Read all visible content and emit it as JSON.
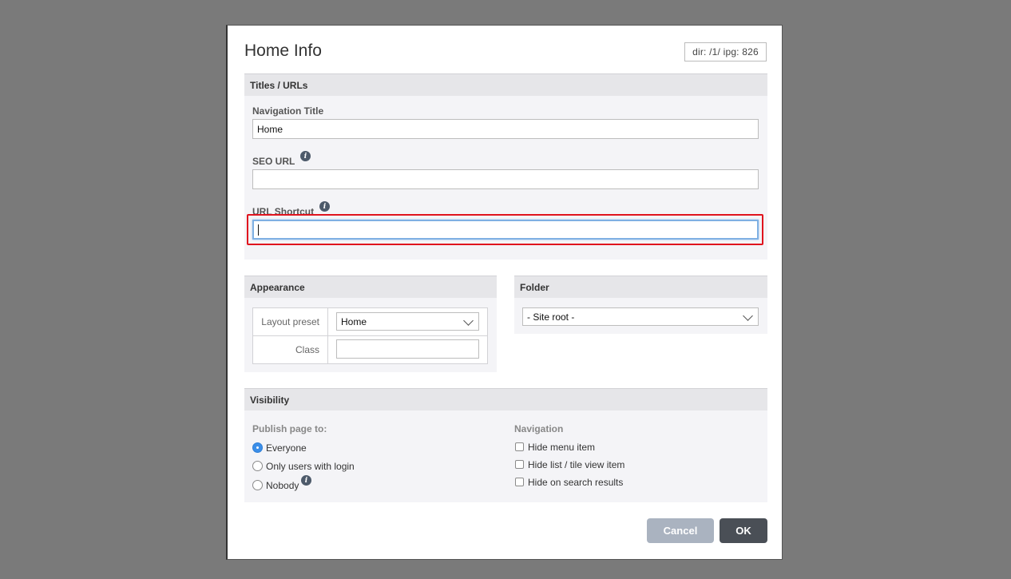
{
  "dialog": {
    "title": "Home Info",
    "dir_info": "dir: /1/  ipg: 826"
  },
  "titles_urls": {
    "header": "Titles / URLs",
    "nav_title_label": "Navigation Title",
    "nav_title_value": "Home",
    "seo_url_label": "SEO URL",
    "seo_url_value": "",
    "url_shortcut_label": "URL Shortcut",
    "url_shortcut_value": "",
    "info_icon": "info-icon"
  },
  "appearance": {
    "header": "Appearance",
    "layout_preset_label": "Layout preset",
    "layout_preset_value": "Home",
    "class_label": "Class",
    "class_value": ""
  },
  "folder": {
    "header": "Folder",
    "value": "- Site root -"
  },
  "visibility": {
    "header": "Visibility",
    "publish_label": "Publish page to:",
    "publish_options": [
      "Everyone",
      "Only users with login",
      "Nobody"
    ],
    "publish_selected": "Everyone",
    "navigation_label": "Navigation",
    "navigation_options": [
      "Hide menu item",
      "Hide list / tile view item",
      "Hide on search results"
    ]
  },
  "buttons": {
    "cancel": "Cancel",
    "ok": "OK"
  },
  "colors": {
    "backdrop": "#7a7a7a",
    "highlight": "#e0141e",
    "radio_selected": "#3b8ee8",
    "ok_button": "#4a4f56",
    "cancel_button": "#aab3c0"
  }
}
